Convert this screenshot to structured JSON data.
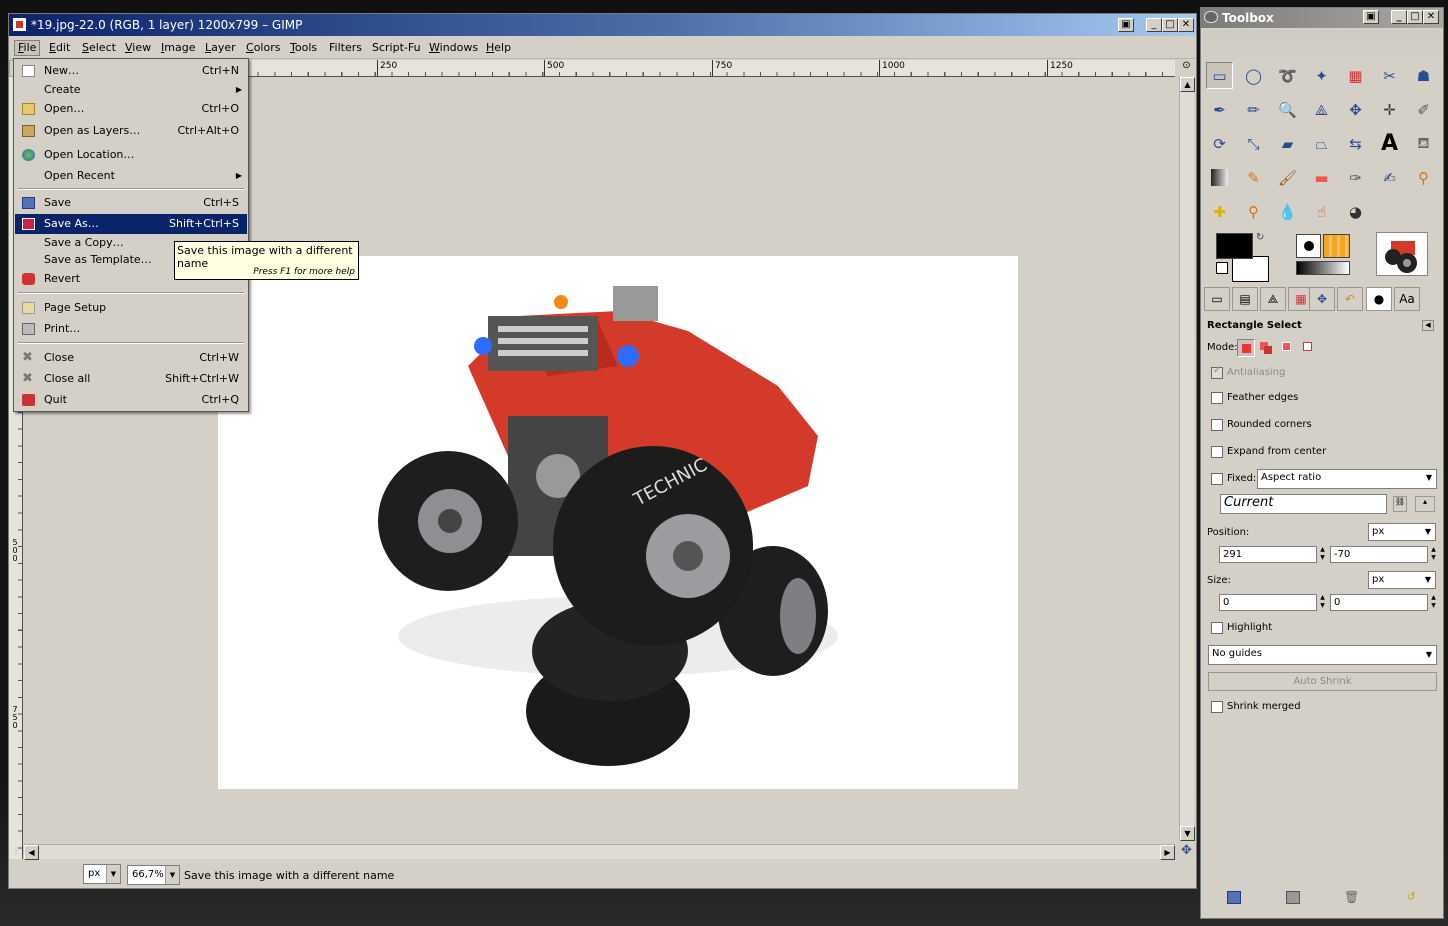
{
  "window": {
    "title": "*19.jpg-22.0 (RGB, 1 layer) 1200x799 – GIMP"
  },
  "menubar": [
    {
      "label": "File",
      "mnemonic": "F",
      "rest": "ile"
    },
    {
      "label": "Edit",
      "mnemonic": "E",
      "rest": "dit"
    },
    {
      "label": "Select",
      "mnemonic": "S",
      "rest": "elect"
    },
    {
      "label": "View",
      "mnemonic": "V",
      "rest": "iew"
    },
    {
      "label": "Image",
      "mnemonic": "I",
      "rest": "mage"
    },
    {
      "label": "Layer",
      "mnemonic": "L",
      "rest": "ayer"
    },
    {
      "label": "Colors",
      "mnemonic": "C",
      "rest": "olors"
    },
    {
      "label": "Tools",
      "mnemonic": "T",
      "rest": "ools"
    },
    {
      "label": "Filters",
      "mnemonic": "",
      "rest": "Filters"
    },
    {
      "label": "Script-Fu",
      "mnemonic": "",
      "rest": "Script-Fu"
    },
    {
      "label": "Windows",
      "mnemonic": "W",
      "rest": "indows"
    },
    {
      "label": "Help",
      "mnemonic": "H",
      "rest": "elp"
    }
  ],
  "ruler": {
    "h_labels": [
      "250",
      "500",
      "750",
      "1000",
      "1250"
    ],
    "v_labels": [
      "500",
      "750"
    ]
  },
  "file_menu": {
    "items": [
      {
        "label": "New…",
        "accel": "Ctrl+N",
        "icon": "new-icon"
      },
      {
        "label": "Create",
        "accel": "",
        "submenu": true
      },
      {
        "label": "Open…",
        "accel": "Ctrl+O",
        "icon": "open-icon"
      },
      {
        "label": "Open as Layers…",
        "accel": "Ctrl+Alt+O",
        "icon": "open-layers-icon"
      },
      {
        "label": "Open Location…",
        "accel": "",
        "icon": "globe-icon"
      },
      {
        "label": "Open Recent",
        "accel": "",
        "submenu": true
      },
      {
        "label": "Save",
        "accel": "Ctrl+S",
        "icon": "save-icon"
      },
      {
        "label": "Save As…",
        "accel": "Shift+Ctrl+S",
        "icon": "save-as-icon",
        "selected": true
      },
      {
        "label": "Save a Copy…",
        "accel": ""
      },
      {
        "label": "Save as Template…",
        "accel": ""
      },
      {
        "label": "Revert",
        "accel": "",
        "icon": "revert-icon"
      },
      {
        "label": "Page Setup",
        "accel": "",
        "icon": "page-setup-icon"
      },
      {
        "label": "Print…",
        "accel": "",
        "icon": "print-icon"
      },
      {
        "label": "Close",
        "accel": "Ctrl+W",
        "icon": "close-icon"
      },
      {
        "label": "Close all",
        "accel": "Shift+Ctrl+W",
        "icon": "close-all-icon"
      },
      {
        "label": "Quit",
        "accel": "Ctrl+Q",
        "icon": "quit-icon"
      }
    ]
  },
  "tooltip": {
    "text": "Save this image with a different name",
    "help": "Press F1 for more help"
  },
  "statusbar": {
    "unit": "px",
    "zoom": "66,7%",
    "message": "Save this image with a different name"
  },
  "toolbox": {
    "title": "Toolbox",
    "tool_options_title": "Rectangle Select",
    "mode_label": "Mode:",
    "antialiasing": "Antialiasing",
    "feather_edges": "Feather edges",
    "rounded_corners": "Rounded corners",
    "expand_from_center": "Expand from center",
    "fixed_label": "Fixed:",
    "fixed_value": "Aspect ratio",
    "current_value": "Current",
    "position_label": "Position:",
    "position_unit": "px",
    "position_x": "291",
    "position_y": "-70",
    "size_label": "Size:",
    "size_unit": "px",
    "size_w": "0",
    "size_h": "0",
    "highlight": "Highlight",
    "guides": "No guides",
    "auto_shrink": "Auto Shrink",
    "shrink_merged": "Shrink merged",
    "font_tab": "Aa"
  },
  "colors": {
    "menu_select": "#0a246a",
    "tooltip_bg": "#ffffe1",
    "fg_color": "#000000",
    "bg_color": "#ffffff",
    "brush_color": "#f5a623"
  }
}
